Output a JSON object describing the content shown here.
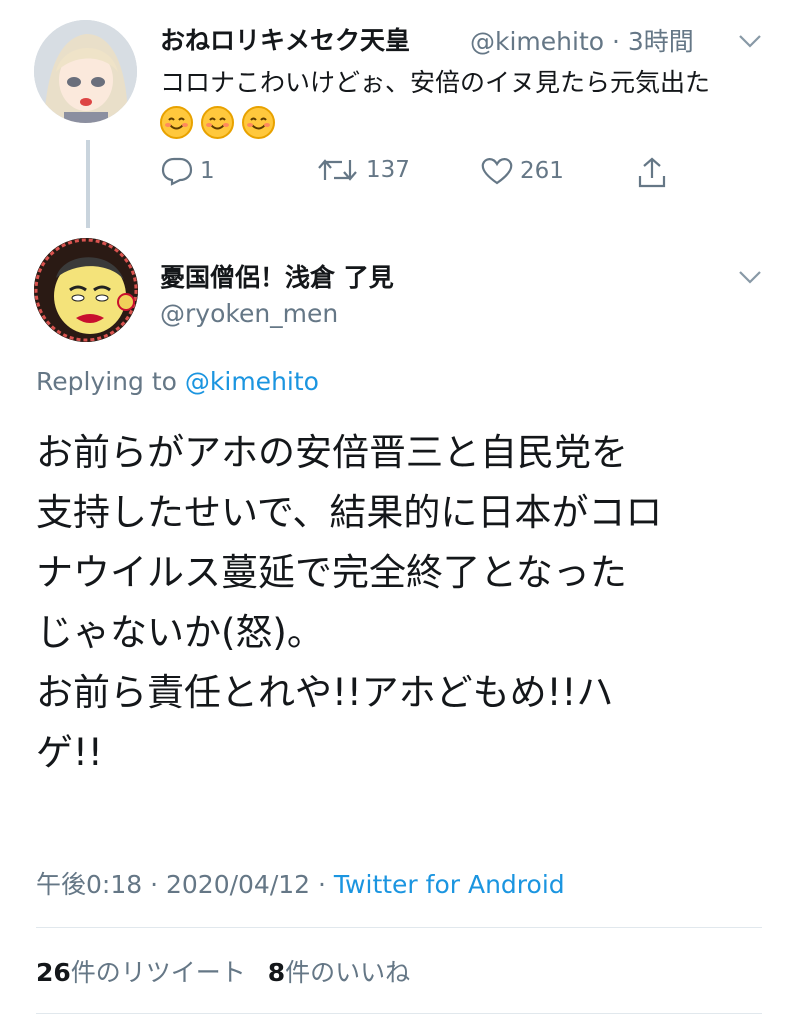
{
  "parent_tweet": {
    "display_name": "おねロリキメセク天皇",
    "handle": "@kimehito",
    "time_ago": "3時間",
    "text": "コロナこわいけどぉ、安倍のイヌ見たら元気出た",
    "emoji": [
      "smiling-face-emoji",
      "smiling-face-emoji",
      "smiling-face-emoji"
    ],
    "actions": {
      "reply_count": "1",
      "retweet_count": "137",
      "like_count": "261"
    }
  },
  "main_tweet": {
    "display_name": "憂国僧侶！浅倉 了見",
    "handle": "@ryoken_men",
    "replying_label": "Replying to",
    "replying_to": "@kimehito",
    "lines": [
      "お前らがアホの安倍晋三と自民党を",
      "支持したせいで、結果的に日本がコロ",
      "ナウイルス蔓延で完全終了となった",
      "じゃないか(怒)。",
      "お前ら責任とれや!!アホどもめ!!ハ",
      "ゲ!!"
    ],
    "time": "午後0:18",
    "date": "2020/04/12",
    "source": "Twitter for Android",
    "retweets_count": "26",
    "retweets_label": "件のリツイート",
    "likes_count": "8",
    "likes_label": "件のいいね"
  },
  "colors": {
    "link": "#1b95e0",
    "muted": "#657786",
    "text": "#14171a",
    "thread_line": "#c9d4dd"
  }
}
